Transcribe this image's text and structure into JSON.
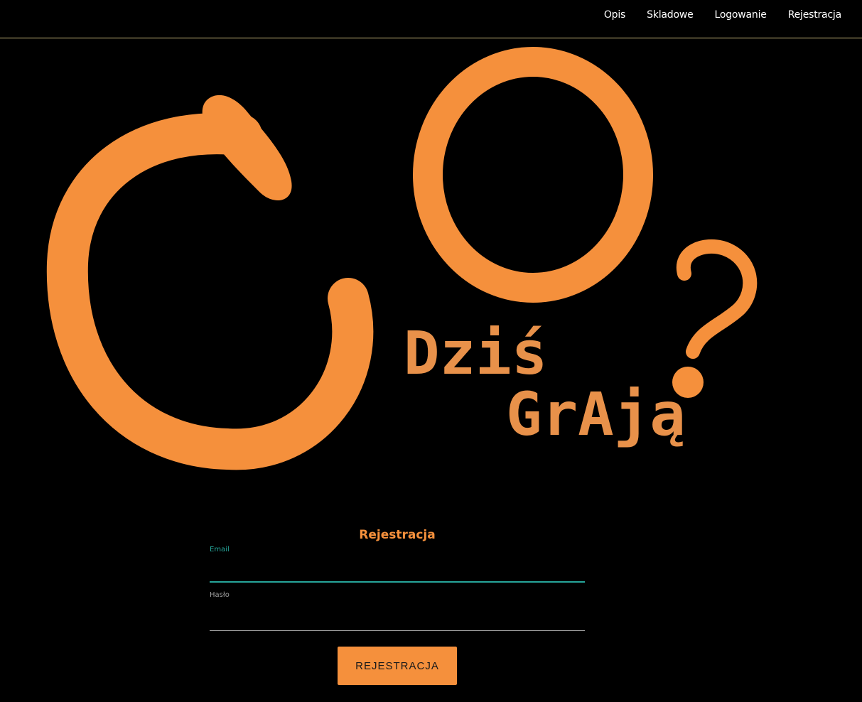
{
  "nav": {
    "items": [
      {
        "label": "Opis"
      },
      {
        "label": "Skladowe"
      },
      {
        "label": "Logowanie"
      },
      {
        "label": "Rejestracja"
      }
    ]
  },
  "logo": {
    "line1": "Dziś",
    "line2": "GrAją",
    "color": "#f5903c"
  },
  "form": {
    "title": "Rejestracja",
    "email_label": "Email",
    "email_value": "",
    "password_label": "Hasło",
    "password_value": "",
    "submit_label": "REJESTRACJA"
  },
  "colors": {
    "accent": "#f5903c",
    "focus": "#26a69a",
    "muted": "#9e9e9e",
    "background": "#000000"
  }
}
